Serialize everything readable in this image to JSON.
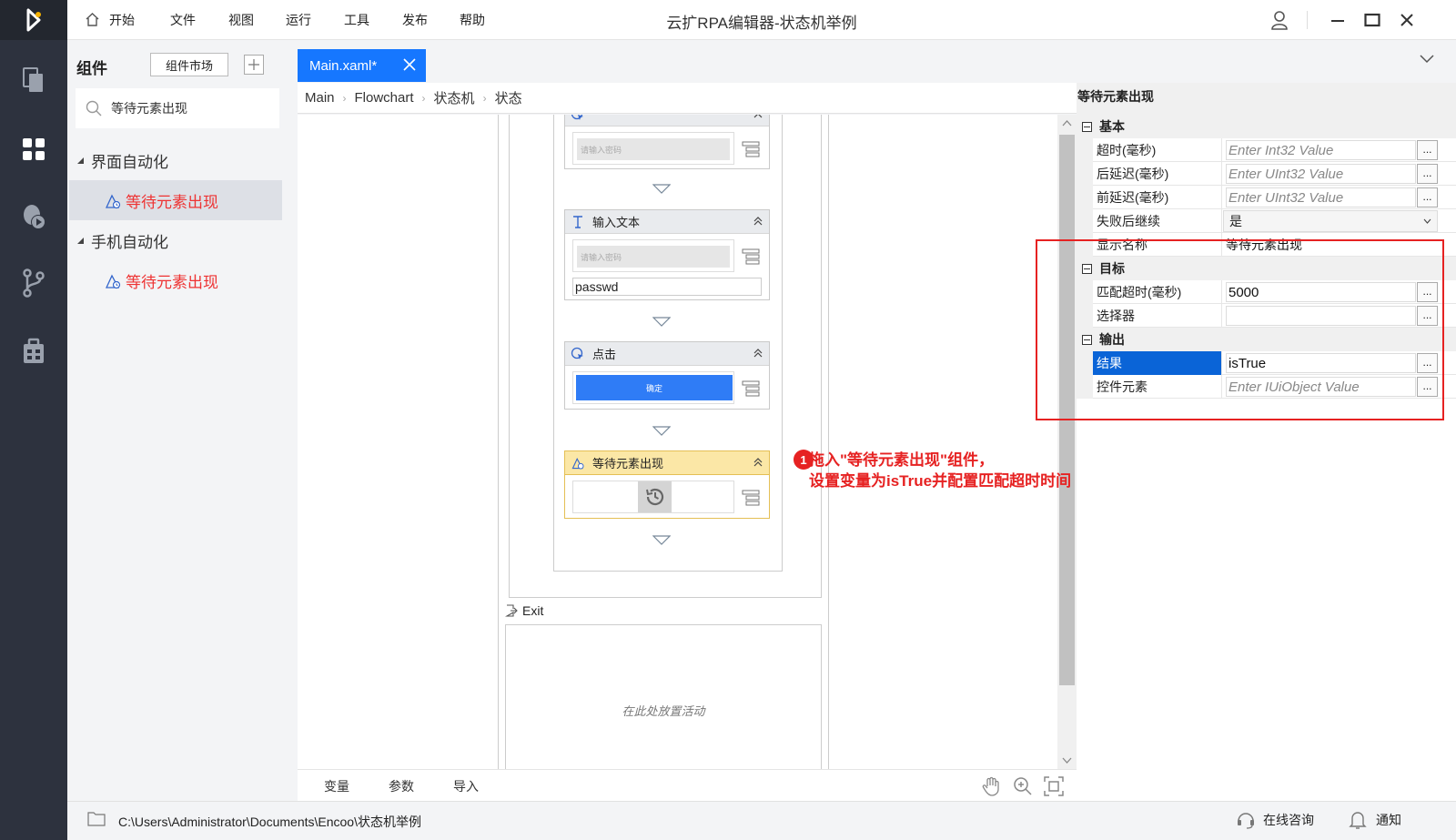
{
  "app": {
    "title": "云扩RPA编辑器-状态机举例",
    "menu": [
      "开始",
      "文件",
      "视图",
      "运行",
      "工具",
      "发布",
      "帮助"
    ]
  },
  "components": {
    "title": "组件",
    "market_button": "组件市场",
    "search_value": "等待元素出现",
    "tree": [
      {
        "category": "界面自动化",
        "item": "等待元素出现",
        "selected": true
      },
      {
        "category": "手机自动化",
        "item": "等待元素出现",
        "selected": false
      }
    ]
  },
  "tab": {
    "label": "Main.xaml*"
  },
  "breadcrumb": [
    "Main",
    "Flowchart",
    "状态机",
    "状态"
  ],
  "canvas": {
    "card0_shot": "请输入密码",
    "card1": {
      "title": "输入文本",
      "shot": "请输入密码",
      "value": "passwd"
    },
    "card2": {
      "title": "点击",
      "button_text": "确定"
    },
    "card3": {
      "title": "等待元素出现"
    },
    "exit_label": "Exit",
    "exit_placeholder": "在此处放置活动",
    "bottom_tabs": [
      "变量",
      "参数",
      "导入"
    ]
  },
  "annotation": {
    "badge": "1",
    "line1": "拖入\"等待元素出现\"组件，",
    "line2": "设置变量为isTrue并配置匹配超时时间"
  },
  "properties": {
    "header": "等待元素出现",
    "sections": {
      "basic": "基本",
      "target": "目标",
      "output": "输出"
    },
    "rows": {
      "timeout": {
        "label": "超时(毫秒)",
        "placeholder": "Enter Int32 Value"
      },
      "delay_after": {
        "label": "后延迟(毫秒)",
        "placeholder": "Enter UInt32 Value"
      },
      "delay_before": {
        "label": "前延迟(毫秒)",
        "placeholder": "Enter UInt32 Value"
      },
      "continue_on_error": {
        "label": "失败后继续",
        "value": "是"
      },
      "display_name": {
        "label": "显示名称",
        "value": "等待元素出现"
      },
      "match_timeout": {
        "label": "匹配超时(毫秒)",
        "value": "5000"
      },
      "selector": {
        "label": "选择器",
        "value": ""
      },
      "result": {
        "label": "结果",
        "value": "isTrue"
      },
      "ui_element": {
        "label": "控件元素",
        "placeholder": "Enter IUiObject Value"
      }
    },
    "dots_label": "..."
  },
  "status": {
    "path": "C:\\Users\\Administrator\\Documents\\Encoo\\状态机举例",
    "consult": "在线咨询",
    "notify": "通知"
  },
  "colors": {
    "accent": "#1677ff",
    "annotation": "#e62222",
    "rail": "#2d323e",
    "link_red": "#e33333"
  }
}
